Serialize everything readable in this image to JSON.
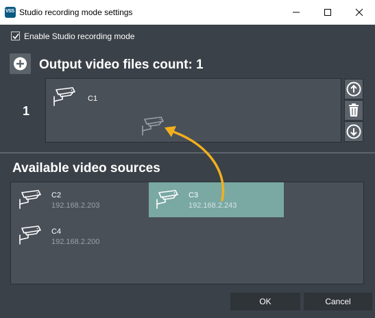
{
  "window": {
    "title": "Studio recording mode settings",
    "logo_text": "VSS"
  },
  "settings": {
    "enable_label": "Enable Studio recording mode",
    "enable_checked": true
  },
  "output": {
    "title": "Output video files count: 1",
    "files": [
      {
        "index": "1",
        "cameras": [
          {
            "name": "C1"
          }
        ]
      }
    ]
  },
  "available": {
    "title": "Available video sources",
    "sources": [
      {
        "name": "C2",
        "ip": "192.168.2.203",
        "selected": false
      },
      {
        "name": "C3",
        "ip": "192.168.2.243",
        "selected": true
      },
      {
        "name": "C4",
        "ip": "192.168.2.200",
        "selected": false
      }
    ]
  },
  "footer": {
    "ok_label": "OK",
    "cancel_label": "Cancel"
  },
  "colors": {
    "background": "#3b4148",
    "panel": "#4a5058",
    "selection": "#7aa8a3",
    "drag_arrow": "#f2b01e"
  }
}
